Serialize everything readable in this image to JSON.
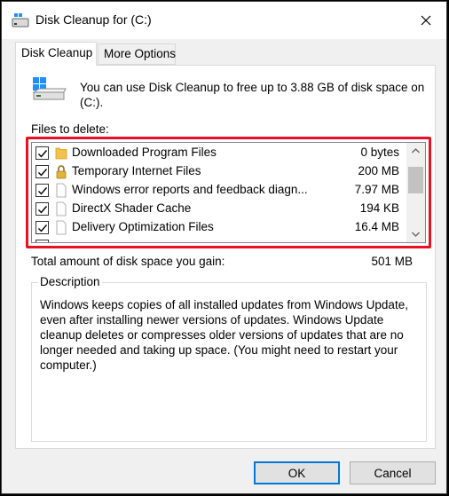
{
  "window": {
    "title": "Disk Cleanup for  (C:)"
  },
  "tabs": [
    {
      "label": "Disk Cleanup",
      "active": true
    },
    {
      "label": "More Options",
      "active": false
    }
  ],
  "intro_text": "You can use Disk Cleanup to free up to 3.88 GB of disk space on (C:).",
  "files_label": "Files to delete:",
  "files": [
    {
      "name": "Downloaded Program Files",
      "size": "0 bytes",
      "checked": true,
      "icon": "folder-icon"
    },
    {
      "name": "Temporary Internet Files",
      "size": "200 MB",
      "checked": true,
      "icon": "lock-icon"
    },
    {
      "name": "Windows error reports and feedback diagn...",
      "size": "7.97 MB",
      "checked": true,
      "icon": "file-icon"
    },
    {
      "name": "DirectX Shader Cache",
      "size": "194 KB",
      "checked": true,
      "icon": "file-icon"
    },
    {
      "name": "Delivery Optimization Files",
      "size": "16.4 MB",
      "checked": true,
      "icon": "file-icon"
    }
  ],
  "total": {
    "label": "Total amount of disk space you gain:",
    "value": "501 MB"
  },
  "description": {
    "legend": "Description",
    "text": "Windows keeps copies of all installed updates from Windows Update, even after installing newer versions of updates. Windows Update cleanup deletes or compresses older versions of updates that are no longer needed and taking up space. (You might need to restart your computer.)"
  },
  "buttons": {
    "ok": "OK",
    "cancel": "Cancel"
  },
  "colors": {
    "highlight": "#e81123",
    "accent": "#0078d7"
  }
}
